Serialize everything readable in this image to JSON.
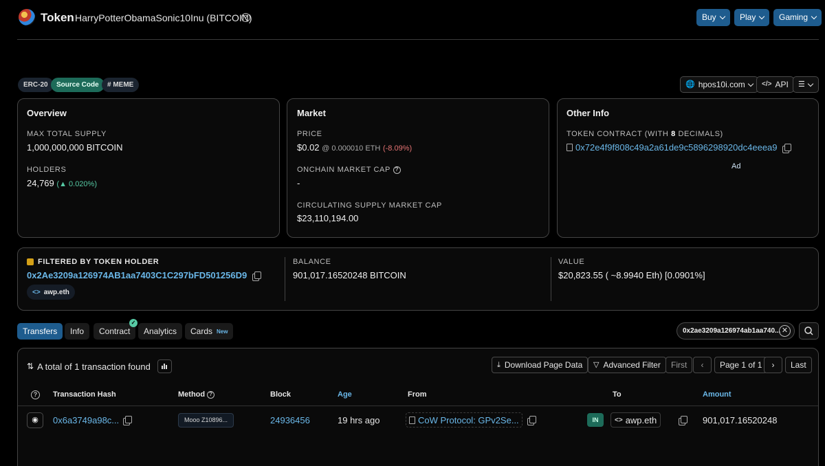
{
  "header": {
    "title": "Token",
    "token_name": "HarryPotterObamaSonic10Inu (BITCOIN)",
    "buttons": [
      "Buy",
      "Play",
      "Gaming"
    ]
  },
  "tags": [
    "ERC-20",
    "Source Code",
    "MEME"
  ],
  "toolbar": {
    "site": "hpos10i.com",
    "api": "API"
  },
  "overview": {
    "title": "Overview",
    "max_supply_label": "MAX TOTAL SUPPLY",
    "max_supply_value": "1,000,000,000 BITCOIN",
    "holders_label": "HOLDERS",
    "holders_value": "24,769",
    "holders_change": "0.020%"
  },
  "market": {
    "title": "Market",
    "price_label": "PRICE",
    "price_value": "$0.02",
    "price_eth": "0.000010 ETH",
    "price_change": "(-8.09%)",
    "onchain_label": "ONCHAIN MARKET CAP",
    "onchain_value": "-",
    "circ_label": "CIRCULATING SUPPLY MARKET CAP",
    "circ_value": "$23,110,194.00"
  },
  "other_info": {
    "title": "Other Info",
    "contract_label_pre": "TOKEN CONTRACT (WITH ",
    "contract_decimals": "8",
    "contract_label_post": " DECIMALS)",
    "contract_address": "0x72e4f9f808c49a2a61de9c5896298920dc4eeea9",
    "ad": "Ad"
  },
  "filter": {
    "label": "FILTERED BY TOKEN HOLDER",
    "address": "0x2Ae3209a126974AB1aa7403C1C297bFD501256D9",
    "ens": "awp.eth",
    "balance_label": "BALANCE",
    "balance_value": "901,017.16520248 BITCOIN",
    "value_label": "VALUE",
    "value_value": "$20,823.55 ( ~8.9940 Eth) [0.0901%]"
  },
  "tabs": [
    "Transfers",
    "Info",
    "Contract",
    "Analytics",
    "Cards"
  ],
  "tab_new_badge": "New",
  "search_filter": "0x2ae3209a126974ab1aa740...",
  "table": {
    "summary": "A total of 1 transaction found",
    "download": "Download Page Data",
    "advanced_filter": "Advanced Filter",
    "pager": {
      "first": "First",
      "page": "Page 1 of 1",
      "last": "Last"
    },
    "headers": [
      "Transaction Hash",
      "Method",
      "Block",
      "Age",
      "From",
      "To",
      "Amount"
    ],
    "rows": [
      {
        "hash": "0x6a3749a98c...",
        "method": "Mooo Z10896...",
        "block": "24936456",
        "age": "19 hrs ago",
        "from": "CoW Protocol: GPv2Se...",
        "direction": "IN",
        "to": "awp.eth",
        "amount": "901,017.16520248"
      }
    ]
  },
  "colors": {
    "accent": "#1e5c8e",
    "link": "#6ab7e8",
    "positive": "#56c9a4",
    "negative": "#e57373",
    "source_code_tag": "#1d6b59"
  }
}
